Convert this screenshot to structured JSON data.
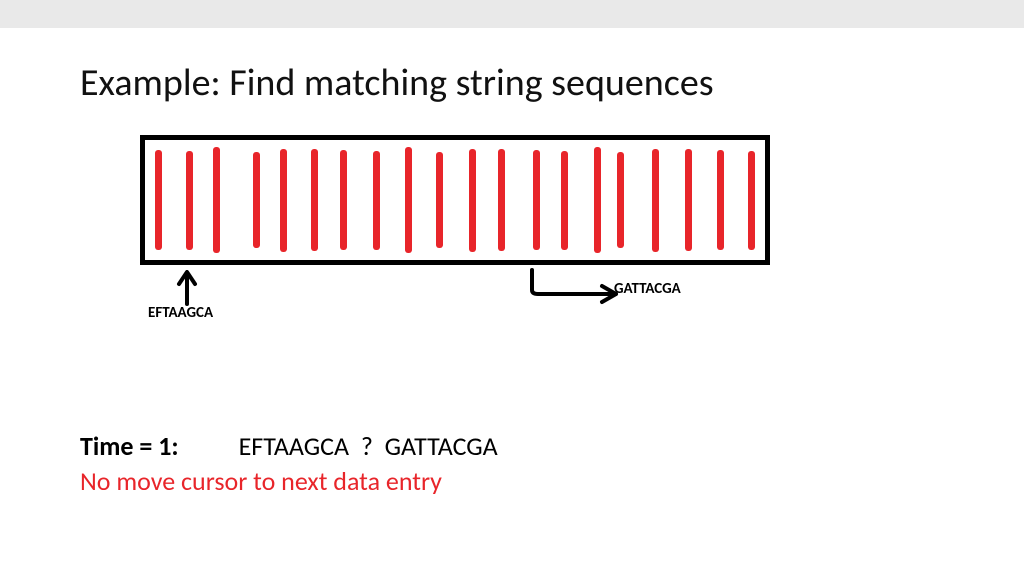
{
  "title": "Example: Find matching string sequences",
  "labels": {
    "left": "EFTAAGCA",
    "right": "GATTACGA"
  },
  "bar_count": 20,
  "time": {
    "label": "Time = 1:",
    "seq_a": "EFTAAGCA",
    "op": "?",
    "seq_b": "GATTACGA"
  },
  "result": "No move cursor to next data entry"
}
